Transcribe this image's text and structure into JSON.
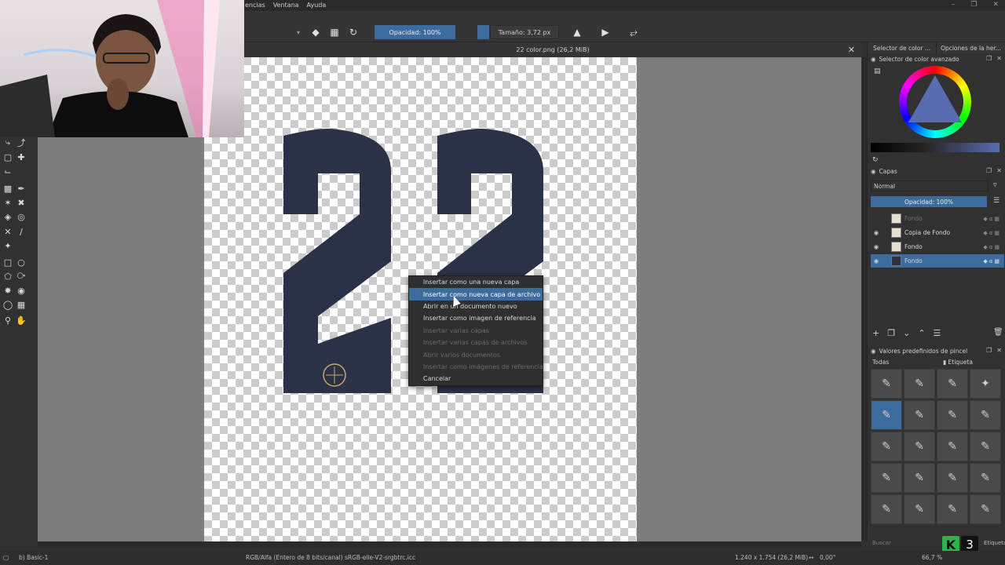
{
  "menubar": {
    "items": [
      "encias",
      "Ventana",
      "Ayuda"
    ]
  },
  "toolbar": {
    "opacity_label": "Opacidad: 100%",
    "size_label": "Tamaño: 3,72 px"
  },
  "document": {
    "title": "22 color.png (26,2 MiB)"
  },
  "context_menu": {
    "items": [
      {
        "label": "Insertar como una nueva capa",
        "state": "normal"
      },
      {
        "label": "Insertar como nueva capa de archivo",
        "state": "highlighted"
      },
      {
        "label": "Abrir en un documento nuevo",
        "state": "normal"
      },
      {
        "label": "Insertar como imagen de referencia",
        "state": "normal"
      },
      {
        "label": "Insertar varias capas",
        "state": "disabled"
      },
      {
        "label": "Insertar varias capas de archivos",
        "state": "disabled"
      },
      {
        "label": "Abrir varios documentos",
        "state": "disabled"
      },
      {
        "label": "Insertar como imágenes de referencia",
        "state": "disabled"
      },
      {
        "label": "Cancelar",
        "state": "normal"
      }
    ]
  },
  "dock": {
    "tabs": [
      "Selector de color ...",
      "Opciones de la her..."
    ],
    "color_panel_title": "Selector de color avanzado",
    "layers_panel_title": "Capas",
    "blend_mode": "Normal",
    "layer_opacity": "Opacidad: 100%",
    "layers": [
      {
        "name": "Fondo",
        "state": "dim"
      },
      {
        "name": "Copia de Fondo",
        "state": "normal"
      },
      {
        "name": "Fondo",
        "state": "normal"
      },
      {
        "name": "Fondo",
        "state": "selected"
      }
    ],
    "brush_panel_title": "Valores predefinidos de pincel",
    "brush_filter": "Todas",
    "brush_tag": "Etiqueta",
    "search_placeholder": "Buscar",
    "tag_label": "Etiqueta"
  },
  "statusbar": {
    "brush": "b) Basic-1",
    "color_profile": "RGB/Alfa (Entero de 8 bits/canal)  sRGB-elle-V2-srgbtrc.icc",
    "dimensions": "1.240 x 1.754 (26,2 MiB)",
    "rotation": "0,00°",
    "zoom": "66,7 %"
  },
  "overlay": {
    "badge_letter": "K",
    "badge_number": "3"
  },
  "colors": {
    "accent": "#3c6b9e",
    "numeral": "#2b3147",
    "canvas_bg": "#7d7d7d"
  }
}
